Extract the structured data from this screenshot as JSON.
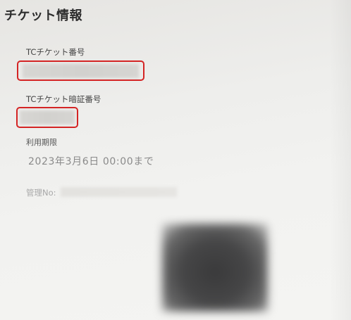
{
  "page": {
    "title": "チケット情報"
  },
  "ticket": {
    "number_label": "TCチケット番号",
    "pin_label": "TCチケット暗証番号",
    "expiry_label": "利用期限",
    "expiry_value": "2023年3月6日 00:00まで",
    "management_label": "管理No:"
  },
  "annotations": {
    "highlight_color": "#d42424"
  }
}
